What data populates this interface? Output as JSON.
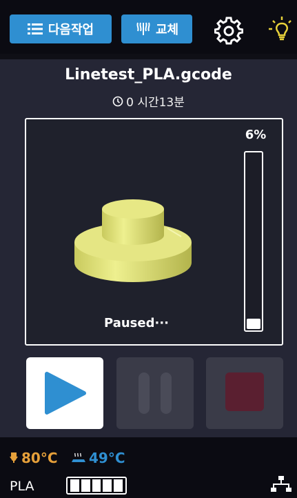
{
  "toolbar": {
    "next_job_label": "다음작업",
    "swap_label": "교체",
    "settings_icon": "gear-icon",
    "light_icon": "bulb-icon"
  },
  "job": {
    "filename": "Linetest_PLA.gcode",
    "time_remaining": "0 시간13분"
  },
  "preview": {
    "status": "Paused···",
    "progress_label": "6%",
    "progress": 0.06
  },
  "controls": {
    "play": "play-icon",
    "pause": "pause-icon",
    "stop": "stop-icon"
  },
  "status_bar": {
    "nozzle_temp": "80°C",
    "bed_temp": "49°C",
    "material": "PLA",
    "filament_level": 1.0
  },
  "colors": {
    "accent": "#2f8fd1",
    "nozzle": "#e6a03a",
    "model": "#e5e684",
    "stop": "#5a1f30"
  }
}
